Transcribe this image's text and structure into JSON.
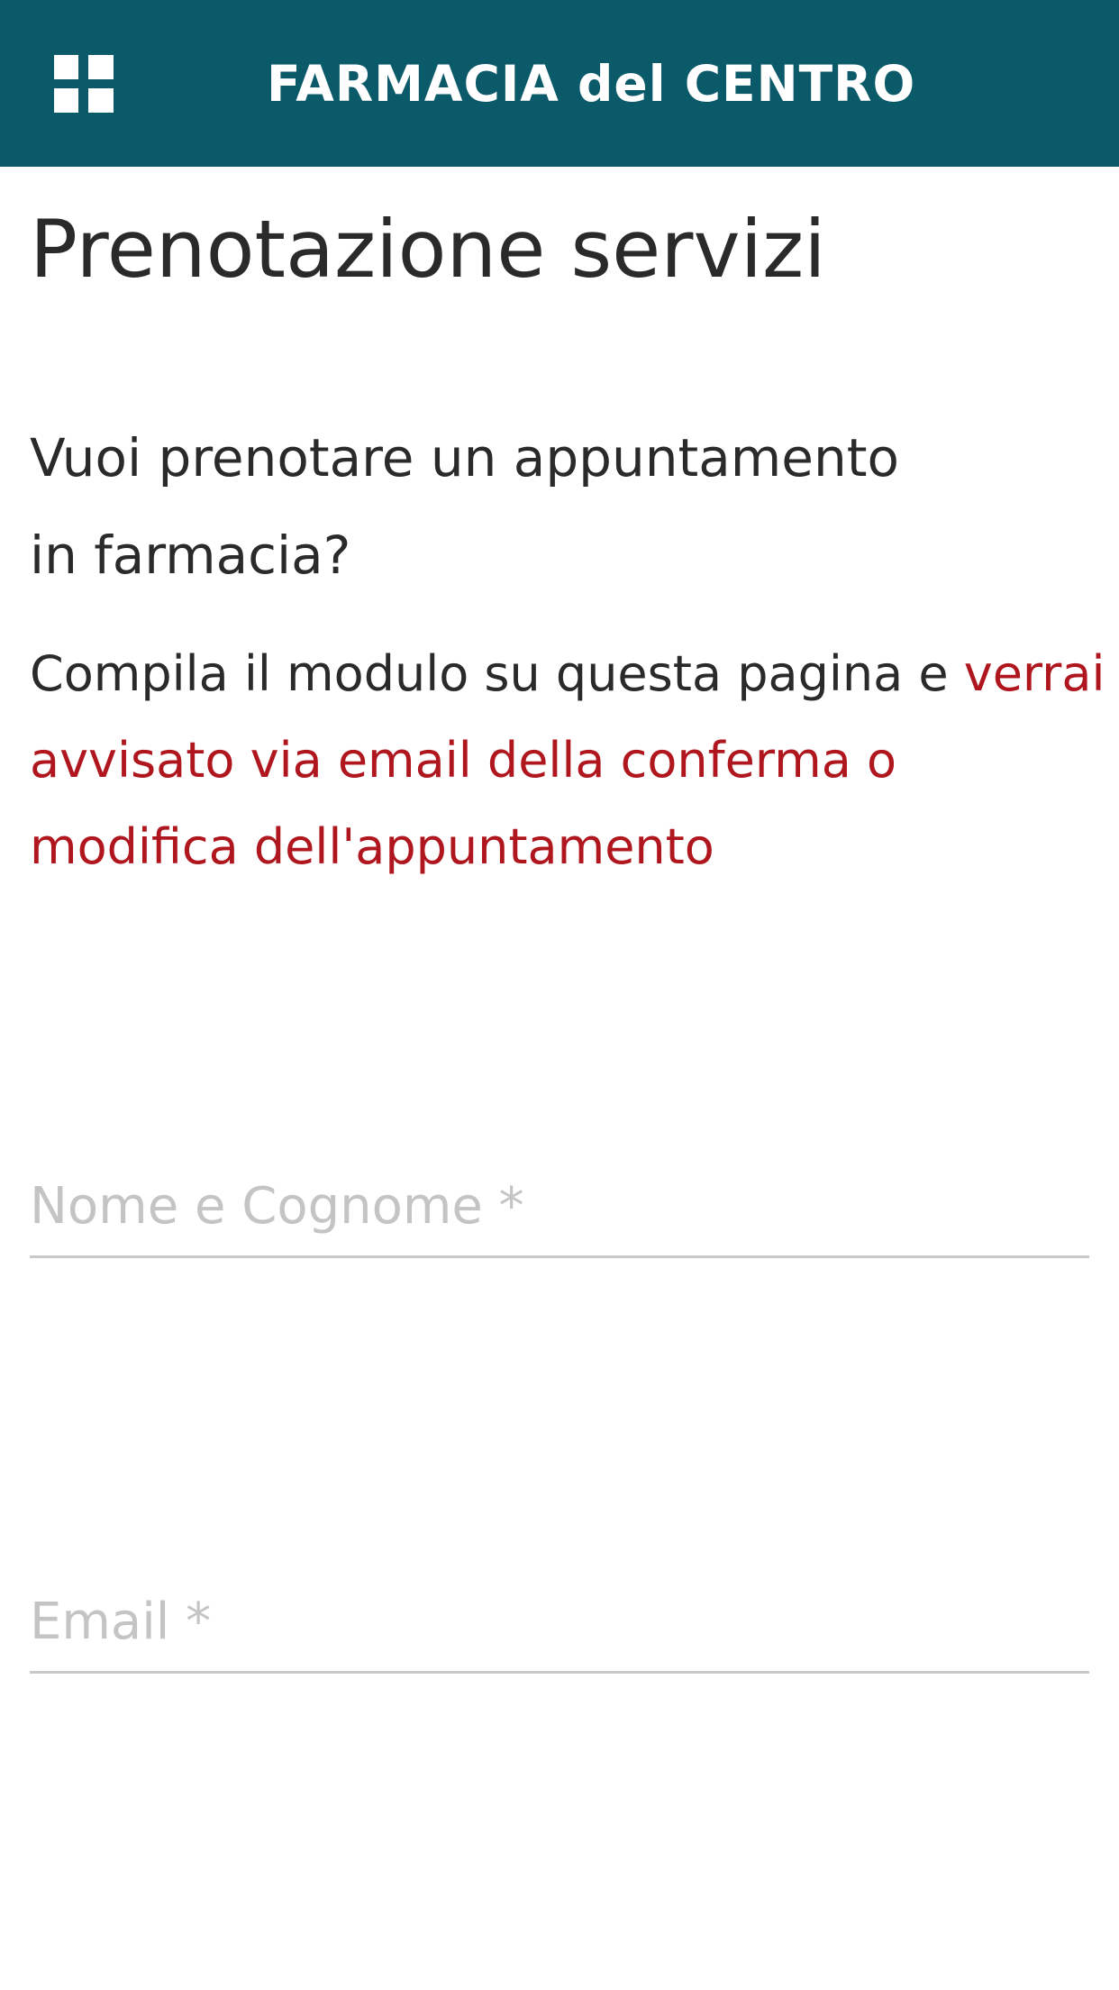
{
  "header": {
    "brand": "FARMACIA del CENTRO",
    "menu_icon": "grid-menu-icon",
    "background_color": "#0a5a6a"
  },
  "page": {
    "title": "Prenotazione servizi",
    "question_line1": "Vuoi prenotare un appuntamento",
    "question_line2": "in farmacia?",
    "info_normal": "Compila il modulo su questa pagina e ",
    "info_red_line1": "verrai",
    "info_red_line2": "avvisato via email della conferma o",
    "info_red_line3": "modifica dell'appuntamento",
    "accent_color": "#b0161e"
  },
  "form": {
    "name_placeholder": "Nome e Cognome *",
    "name_value": "",
    "email_placeholder": "Email *",
    "email_value": ""
  }
}
